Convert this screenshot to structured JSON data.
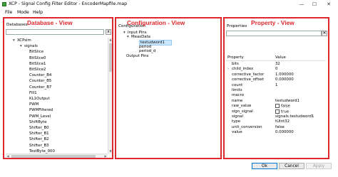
{
  "window": {
    "title": "XCP - Signal Config Filter Editor - EncoderMapfile.map",
    "minimize": "—",
    "maximize": "☐",
    "close": "✕"
  },
  "menu": [
    "File",
    "Mode",
    "Help"
  ],
  "annotations": {
    "database": "Database - View",
    "configuration": "Configuration - View",
    "property": "Property - View"
  },
  "database_panel": {
    "title": "Databases",
    "search_value": "",
    "search_button": "x",
    "tree": [
      {
        "exp": "▾",
        "label": "XCPsim"
      },
      {
        "exp": "▾",
        "label": "signals"
      },
      {
        "exp": "",
        "label": "BitSlice"
      },
      {
        "exp": "",
        "label": "BitSlice0"
      },
      {
        "exp": "",
        "label": "BitSlice1"
      },
      {
        "exp": "",
        "label": "BitSlice2"
      },
      {
        "exp": "",
        "label": "Counter_B4"
      },
      {
        "exp": "",
        "label": "Counter_B5"
      },
      {
        "exp": "",
        "label": "Counter_B7"
      },
      {
        "exp": "",
        "label": "Fill1"
      },
      {
        "exp": "",
        "label": "KL1Output"
      },
      {
        "exp": "",
        "label": "PWM"
      },
      {
        "exp": "",
        "label": "PWMFiltered"
      },
      {
        "exp": "",
        "label": "PWM_Level"
      },
      {
        "exp": "",
        "label": "ShiftByte"
      },
      {
        "exp": "",
        "label": "Shifter_B0"
      },
      {
        "exp": "",
        "label": "Shifter_B1"
      },
      {
        "exp": "",
        "label": "Shifter_B2"
      },
      {
        "exp": "",
        "label": "Shifter_B3"
      },
      {
        "exp": "",
        "label": "TestByte_000"
      }
    ]
  },
  "configuration_panel": {
    "title": "Configuration",
    "tree": [
      {
        "exp": "▾",
        "label": "Input Pins"
      },
      {
        "exp": "▾",
        "label": "MeasData"
      },
      {
        "exp": "",
        "label": "testudword1",
        "selected": true
      },
      {
        "exp": "",
        "label": "period"
      },
      {
        "exp": "",
        "label": "period_d"
      },
      {
        "exp": "",
        "label": "Output Pins"
      }
    ]
  },
  "properties_panel": {
    "title": "Properties",
    "search_value": "",
    "clear_button": "✕",
    "header": {
      "property": "Property",
      "value": "Value"
    },
    "rows": [
      {
        "ex": "",
        "key": "bits",
        "value": "32"
      },
      {
        "ex": "›",
        "key": "child_index",
        "value": "0"
      },
      {
        "ex": "",
        "key": "corrective_factor",
        "value": "1.000000"
      },
      {
        "ex": "",
        "key": "corrective_offset",
        "value": "0.000000"
      },
      {
        "ex": "",
        "key": "count",
        "value": "1"
      },
      {
        "ex": "",
        "key": "limits",
        "value": ""
      },
      {
        "ex": "",
        "key": "macro",
        "value": ""
      },
      {
        "ex": "",
        "key": "name",
        "value": "testudword1"
      },
      {
        "ex": "",
        "key": "raw_value",
        "value": "false",
        "checkbox": true
      },
      {
        "ex": "",
        "key": "sign_signal",
        "value": "true",
        "checkbox": true
      },
      {
        "ex": "",
        "key": "signal",
        "value": "signals.testudword1"
      },
      {
        "ex": "",
        "key": "type",
        "value": "tUInt32"
      },
      {
        "ex": "",
        "key": "unit_conversion",
        "value": "false"
      },
      {
        "ex": "",
        "key": "value",
        "value": "0.000000"
      }
    ]
  },
  "buttons": {
    "ok": "Ok",
    "cancel": "Cancel",
    "apply": "Apply"
  }
}
